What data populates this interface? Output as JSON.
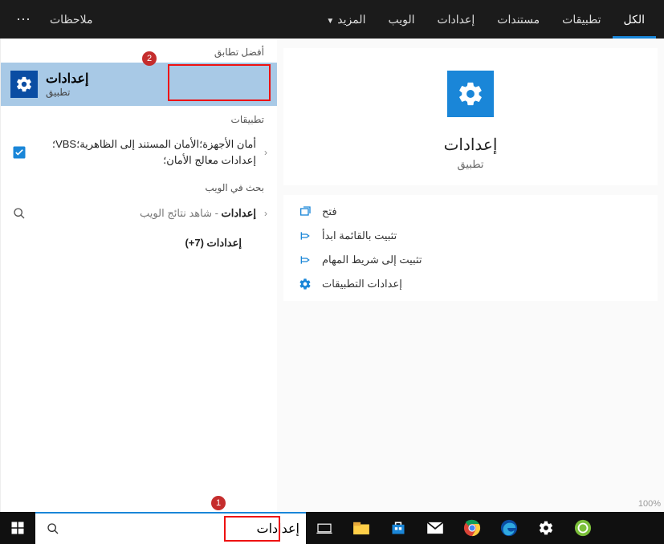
{
  "tabs": {
    "all": "الكل",
    "apps": "تطبيقات",
    "docs": "مستندات",
    "settings": "إعدادات",
    "web": "الويب",
    "more": "المزيد",
    "notes": "ملاحظات"
  },
  "sections": {
    "best_match": "أفضل تطابق",
    "apps": "تطبيقات",
    "web_search": "بحث في الويب"
  },
  "best_match": {
    "title": "إعدادات",
    "subtitle": "تطبيق",
    "badge": "2"
  },
  "app_row": {
    "text": "أمان الأجهزة؛الأمان المستند إلى الظاهرية؛VBS؛إعدادات معالج الأمان؛"
  },
  "web_row": {
    "title": "إعدادات",
    "subtitle": " - شاهد نتائج الويب"
  },
  "more_row": "إعدادات (7+)",
  "detail": {
    "title": "إعدادات",
    "subtitle": "تطبيق",
    "actions": {
      "open": "فتح",
      "pin_start": "تثبيت بالقائمة ابدأ",
      "pin_taskbar": "تثبيت إلى شريط المهام",
      "app_settings": "إعدادات التطبيقات"
    }
  },
  "search": {
    "value": "إعدادات",
    "badge": "1"
  },
  "zoom": "100%"
}
